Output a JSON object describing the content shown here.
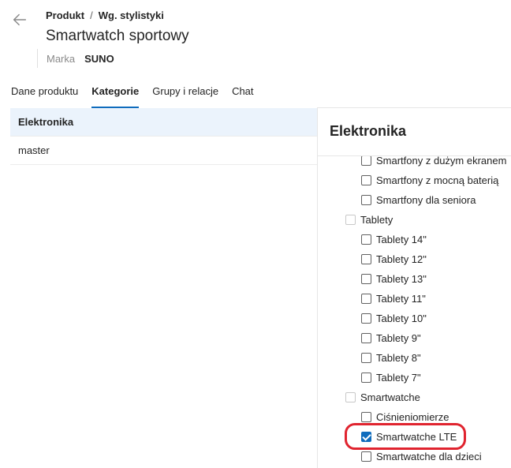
{
  "header": {
    "breadcrumb": {
      "root": "Produkt",
      "separator": "/",
      "current": "Wg. stylistyki"
    },
    "title": "Smartwatch sportowy",
    "brand_label": "Marka",
    "brand_value": "SUNO"
  },
  "tabs": [
    {
      "label": "Dane produktu",
      "active": false
    },
    {
      "label": "Kategorie",
      "active": true
    },
    {
      "label": "Grupy i relacje",
      "active": false
    },
    {
      "label": "Chat",
      "active": false
    }
  ],
  "category_list": [
    {
      "label": "Elektronika",
      "selected": true
    },
    {
      "label": "master",
      "selected": false
    }
  ],
  "right_panel": {
    "title": "Elektronika",
    "tree": [
      {
        "label": "Smartfony z dużym ekranem",
        "level": 2,
        "checked": false
      },
      {
        "label": "Smartfony z mocną baterią",
        "level": 2,
        "checked": false
      },
      {
        "label": "Smartfony dla seniora",
        "level": 2,
        "checked": false
      },
      {
        "label": "Tablety",
        "level": 1,
        "checked": false
      },
      {
        "label": "Tablety 14\"",
        "level": 2,
        "checked": false
      },
      {
        "label": "Tablety 12\"",
        "level": 2,
        "checked": false
      },
      {
        "label": "Tablety 13\"",
        "level": 2,
        "checked": false
      },
      {
        "label": "Tablety 11\"",
        "level": 2,
        "checked": false
      },
      {
        "label": "Tablety 10\"",
        "level": 2,
        "checked": false
      },
      {
        "label": "Tablety 9\"",
        "level": 2,
        "checked": false
      },
      {
        "label": "Tablety 8\"",
        "level": 2,
        "checked": false
      },
      {
        "label": "Tablety 7\"",
        "level": 2,
        "checked": false
      },
      {
        "label": "Smartwatche",
        "level": 1,
        "checked": false
      },
      {
        "label": "Ciśnieniomierze",
        "level": 2,
        "checked": false
      },
      {
        "label": "Smartwatche LTE",
        "level": 2,
        "checked": true
      },
      {
        "label": "Smartwatche dla dzieci",
        "level": 2,
        "checked": false
      }
    ]
  },
  "colors": {
    "accent": "#0f6cbd",
    "selected_row_bg": "#ebf3fc",
    "annotation_ring": "#e0242f"
  },
  "icons": {
    "back": "arrow-left-icon",
    "checkbox": "checkbox-icon"
  }
}
